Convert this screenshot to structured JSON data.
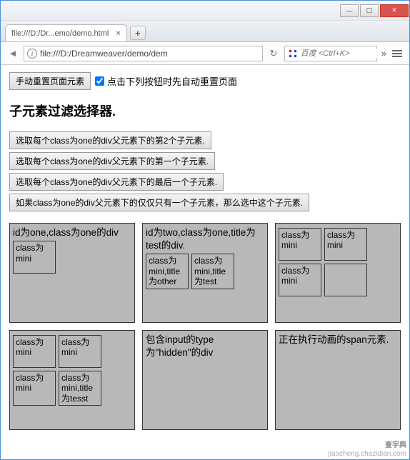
{
  "window": {
    "tab_title": "file:///D:/Dr...emo/demo.html"
  },
  "navbar": {
    "url": "file:///D:/Dreamweaver/demo/dem",
    "search_placeholder": "百度 <Ctrl+K>"
  },
  "top": {
    "reset_button": "手动重置页面元素",
    "checkbox_label": "点击下列按钮时先自动重置页面"
  },
  "section_title": "子元素过滤选择器.",
  "actions": [
    "选取每个class为one的div父元素下的第2个子元素.",
    "选取每个class为one的div父元素下的第一个子元素.",
    "选取每个class为one的div父元素下的最后一个子元素.",
    "如果class为one的div父元素下的仅仅只有一个子元素，那么选中这个子元素."
  ],
  "boxes": [
    {
      "title": "id为one,class为one的div",
      "minis": [
        "class为mini"
      ]
    },
    {
      "title": "id为two,class为one,title为test的div.",
      "minis": [
        "class为mini,title为other",
        "class为mini,title为test"
      ]
    },
    {
      "title": "",
      "minis": [
        "class为mini",
        "class为mini",
        "class为mini",
        ""
      ]
    },
    {
      "title": "",
      "minis": [
        "class为mini",
        "class为mini",
        "class为mini",
        "class为mini,title为tesst"
      ]
    },
    {
      "title": "包含input的type为\"hidden\"的div",
      "minis": []
    },
    {
      "title": "正在执行动画的span元素.",
      "minis": []
    }
  ],
  "watermark1": "查字典",
  "watermark2": "jiaocheng.chazidian.com"
}
